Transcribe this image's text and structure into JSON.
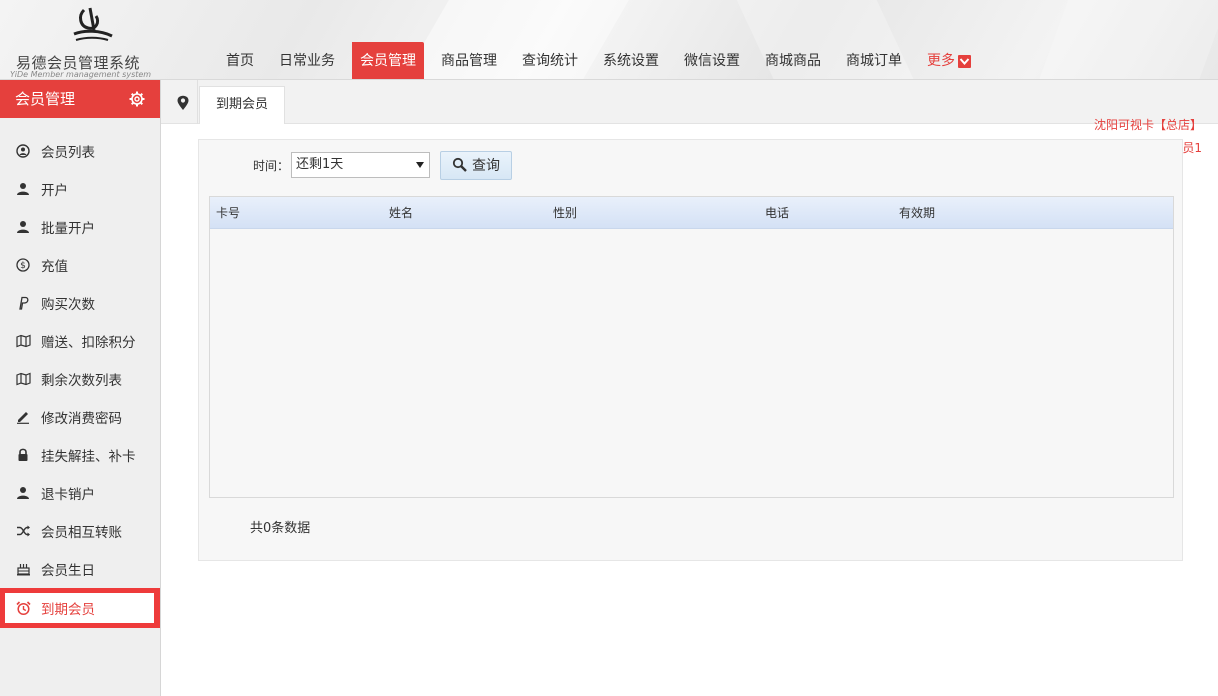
{
  "app": {
    "title_cn": "易德会员管理系统",
    "title_en": "YiDe Member management system"
  },
  "nav": {
    "items": [
      {
        "label": "首页"
      },
      {
        "label": "日常业务"
      },
      {
        "label": "会员管理",
        "active": true
      },
      {
        "label": "商品管理"
      },
      {
        "label": "查询统计"
      },
      {
        "label": "系统设置"
      },
      {
        "label": "微信设置"
      },
      {
        "label": "商城商品"
      },
      {
        "label": "商城订单"
      }
    ],
    "more_label": "更多"
  },
  "sidebar": {
    "title": "会员管理",
    "items": [
      {
        "label": "会员列表",
        "icon": "user-circle-icon"
      },
      {
        "label": "开户",
        "icon": "user-icon"
      },
      {
        "label": "批量开户",
        "icon": "user-icon"
      },
      {
        "label": "充值",
        "icon": "dollar-circle-icon"
      },
      {
        "label": "购买次数",
        "icon": "paypal-icon"
      },
      {
        "label": "赠送、扣除积分",
        "icon": "map-icon"
      },
      {
        "label": "剩余次数列表",
        "icon": "map-icon"
      },
      {
        "label": "修改消费密码",
        "icon": "pencil-icon"
      },
      {
        "label": "挂失解挂、补卡",
        "icon": "lock-icon"
      },
      {
        "label": "退卡销户",
        "icon": "user-icon"
      },
      {
        "label": "会员相互转账",
        "icon": "shuffle-icon"
      },
      {
        "label": "会员生日",
        "icon": "cake-icon"
      },
      {
        "label": "到期会员",
        "icon": "alarm-clock-icon",
        "active": true
      }
    ]
  },
  "tabs": {
    "active_label": "到期会员"
  },
  "notice": {
    "line1": "沈阳可视卡【总店】",
    "line2": "员1"
  },
  "filter": {
    "label": "时间：",
    "selected": "还剩1天",
    "query_label": "查询"
  },
  "table": {
    "columns": [
      "卡号",
      "姓名",
      "性别",
      "电话",
      "有效期"
    ],
    "rows": []
  },
  "summary": "共0条数据",
  "colors": {
    "accent": "#e5403d",
    "sidebar_bg": "#efefef",
    "table_header": "#dbe6f7"
  }
}
